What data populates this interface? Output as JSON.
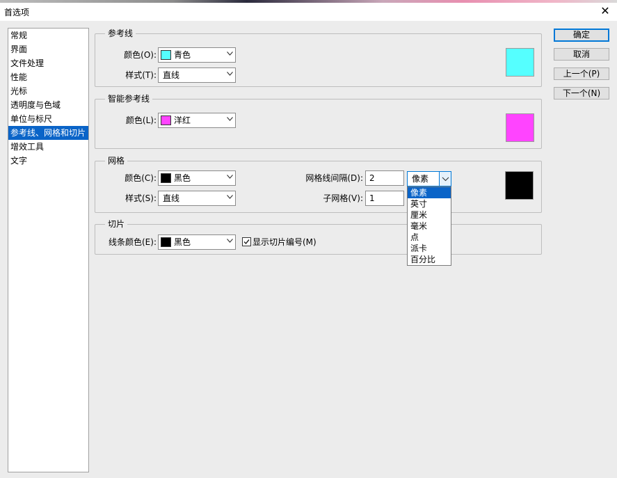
{
  "window": {
    "title": "首选项",
    "close_glyph": "✕"
  },
  "nav": {
    "items": [
      "常规",
      "界面",
      "文件处理",
      "性能",
      "光标",
      "透明度与色域",
      "单位与标尺",
      "参考线、网格和切片",
      "增效工具",
      "文字"
    ],
    "selected_index": 7
  },
  "guides": {
    "title": "参考线",
    "color_label": "颜色(O):",
    "color_value": "青色",
    "color_hex": "#55ffff",
    "style_label": "样式(T):",
    "style_value": "直线"
  },
  "smart_guides": {
    "title": "智能参考线",
    "color_label": "颜色(L):",
    "color_value": "洋红",
    "color_hex": "#ff44ff"
  },
  "grid": {
    "title": "网格",
    "color_label": "颜色(C):",
    "color_value": "黑色",
    "color_hex": "#000000",
    "style_label": "样式(S):",
    "style_value": "直线",
    "gridline_label": "网格线间隔(D):",
    "gridline_value": "2",
    "unit_value": "像素",
    "subdiv_label": "子网格(V):",
    "subdiv_value": "1",
    "unit_options": [
      "像素",
      "英寸",
      "厘米",
      "毫米",
      "点",
      "派卡",
      "百分比"
    ],
    "unit_selected_index": 0
  },
  "slices": {
    "title": "切片",
    "line_color_label": "线条颜色(E):",
    "line_color_value": "黑色",
    "line_color_hex": "#000000",
    "show_numbers_label": "显示切片编号(M)",
    "show_numbers_checked": true
  },
  "buttons": {
    "ok": "确定",
    "cancel": "取消",
    "prev": "上一个(P)",
    "next": "下一个(N)"
  },
  "icons": {
    "dropdown": "chevron-down-icon",
    "checkbox": "checkmark-icon",
    "close": "close-icon"
  }
}
